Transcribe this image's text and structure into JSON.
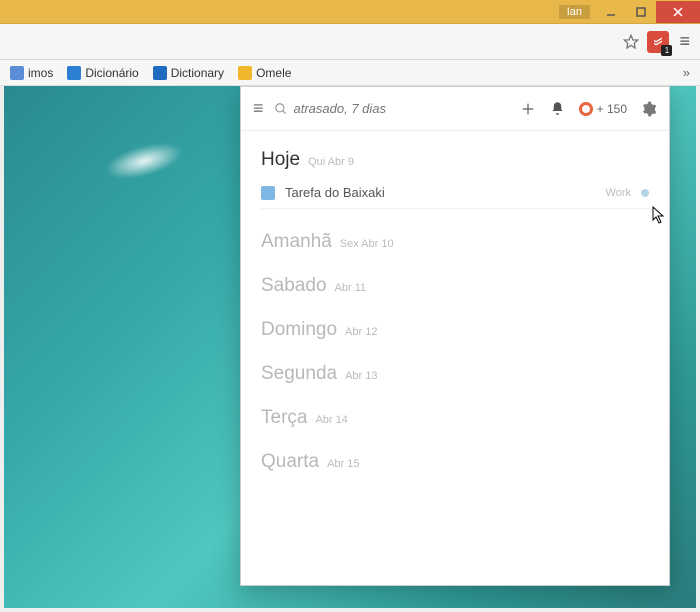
{
  "window": {
    "user_tag": "Ian"
  },
  "bookmarks": {
    "items": [
      {
        "label": "imos",
        "color": "#5b8dd6"
      },
      {
        "label": "Dicionário",
        "color": "#2d7fd4"
      },
      {
        "label": "Dictionary",
        "color": "#1e6bbf"
      },
      {
        "label": "Omele",
        "color": "#f2b52e"
      }
    ]
  },
  "extension": {
    "badge": "1"
  },
  "popup": {
    "search_placeholder": "atrasado, 7 dias",
    "karma_points": "+ 150"
  },
  "days": [
    {
      "name": "Hoje",
      "date": "Qui Abr 9",
      "today": true,
      "tasks": [
        {
          "title": "Tarefa do Baixaki",
          "tag": "Work"
        }
      ]
    },
    {
      "name": "Amanhã",
      "date": "Sex Abr 10"
    },
    {
      "name": "Sabado",
      "date": "Abr 11"
    },
    {
      "name": "Domingo",
      "date": "Abr 12"
    },
    {
      "name": "Segunda",
      "date": "Abr 13"
    },
    {
      "name": "Terça",
      "date": "Abr 14"
    },
    {
      "name": "Quarta",
      "date": "Abr 15"
    }
  ]
}
